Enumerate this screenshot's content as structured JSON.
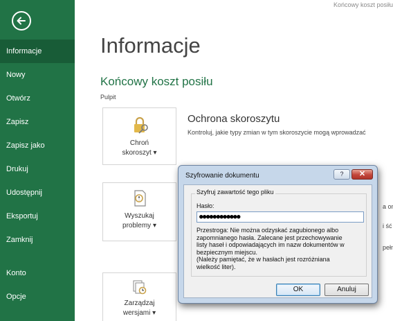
{
  "header": {
    "doc_title": "Końcowy koszt posiłu"
  },
  "sidebar": {
    "back_icon": "back-arrow-circle-icon",
    "items": [
      {
        "label": "Informacje",
        "active": true
      },
      {
        "label": "Nowy"
      },
      {
        "label": "Otwórz"
      },
      {
        "label": "Zapisz"
      },
      {
        "label": "Zapisz jako"
      },
      {
        "label": "Drukuj"
      },
      {
        "label": "Udostępnij"
      },
      {
        "label": "Eksportuj"
      },
      {
        "label": "Zamknij"
      },
      {
        "label": "Konto"
      },
      {
        "label": "Opcje"
      }
    ]
  },
  "main": {
    "title": "Informacje",
    "doc_name": "Końcowy koszt posiłu",
    "doc_location": "Pulpit",
    "tiles": [
      {
        "label_line1": "Chroń",
        "label_line2": "skoroszyt ▾",
        "icon": "lock-key-icon"
      },
      {
        "label_line1": "Wyszukaj",
        "label_line2": "problemy ▾",
        "icon": "inspect-document-icon"
      },
      {
        "label_line1": "Zarządzaj",
        "label_line2": "wersjami ▾",
        "icon": "manage-versions-icon"
      }
    ],
    "protect_section": {
      "title": "Ochrona skoroszytu",
      "description": "Kontroluj, jakie typy zmian w tym skoroszycie mogą wprowadzać"
    },
    "clipped_fragments": [
      "a on",
      "i ść",
      "pełn"
    ]
  },
  "dialog": {
    "title": "Szyfrowanie dokumentu",
    "help_label": "?",
    "close_label": "✕",
    "group_title": "Szyfruj zawartość tego pliku",
    "password_label": "Hasło:",
    "password_value": "●●●●●●●●●●●●",
    "warning": "Przestroga: Nie można odzyskać zagubionego albo\nzapomnianego hasła. Zalecane jest przechowywanie\nlisty haseł i odpowiadających im nazw dokumentów w\nbezpiecznym miejscu.\n(Należy pamiętać, że w hasłach jest rozróżniana\nwielkość liter).",
    "ok_label": "OK",
    "cancel_label": "Anuluj"
  },
  "colors": {
    "accent": "#217346",
    "active_item": "#185c37",
    "dialog_frame": "#c6d7ea"
  }
}
